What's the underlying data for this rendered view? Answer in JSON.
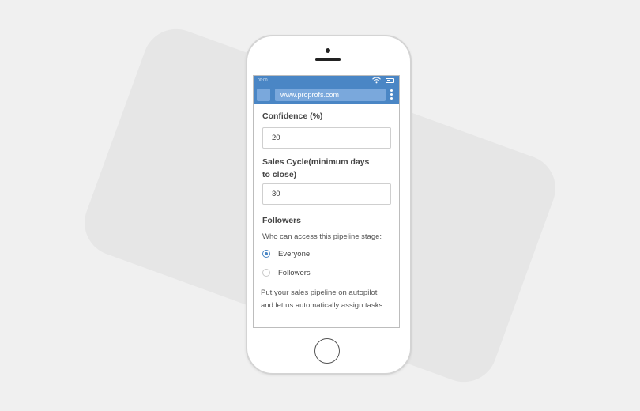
{
  "status_bar": {
    "time": "00:00"
  },
  "browser": {
    "url": "www.proprofs.com"
  },
  "form": {
    "confidence": {
      "label": "Confidence (%)",
      "value": "20"
    },
    "sales_cycle": {
      "label_line1": "Sales Cycle(minimum days",
      "label_line2": "to close)",
      "value": "30"
    },
    "followers": {
      "label": "Followers",
      "question": "Who can access this pipeline stage:",
      "options": [
        {
          "label": "Everyone",
          "selected": true
        },
        {
          "label": "Followers",
          "selected": false
        }
      ]
    },
    "promo_line1": "Put your sales pipeline on autopilot",
    "promo_line2": "and let us automatically assign tasks"
  },
  "colors": {
    "accent": "#4a86c5",
    "url_bar": "#7aa8dc"
  },
  "icons": [
    "wifi-icon",
    "battery-icon",
    "more-vert-icon",
    "home-button"
  ]
}
